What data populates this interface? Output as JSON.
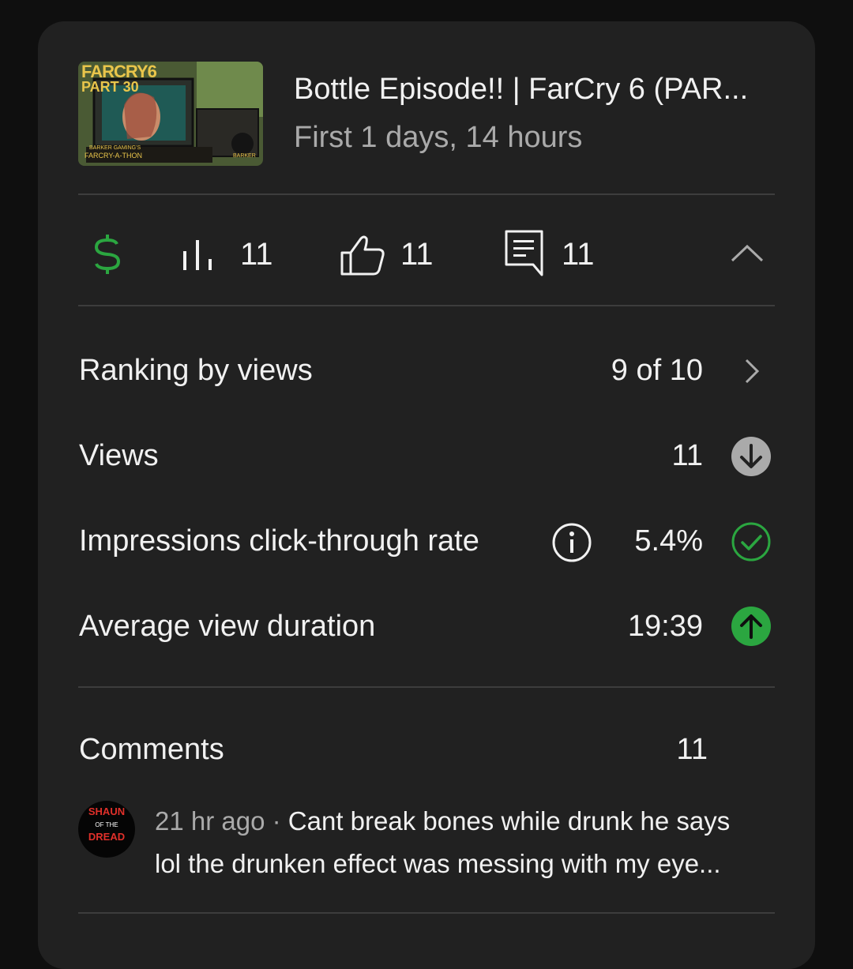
{
  "video": {
    "title": "Bottle Episode!! | FarCry 6 (PAR...",
    "subtitle": "First 1 days, 14 hours",
    "thumbnail": {
      "logo_text": "FARCRY6",
      "part_text": "PART 30",
      "caption_top": "BARKER GAMING'S",
      "caption_bottom": "FARCRY-A-THON",
      "badge_text": "BARKER"
    }
  },
  "stats": {
    "views": "11",
    "likes": "11",
    "comments": "11"
  },
  "metrics": {
    "ranking": {
      "label": "Ranking by views",
      "value": "9 of 10"
    },
    "views": {
      "label": "Views",
      "value": "11"
    },
    "ctr": {
      "label": "Impressions click-through rate",
      "value": "5.4%"
    },
    "avd": {
      "label": "Average view duration",
      "value": "19:39"
    }
  },
  "comments": {
    "label": "Comments",
    "count": "11",
    "items": [
      {
        "avatar_line1": "SHAUN",
        "avatar_line2": "OF THE",
        "avatar_line3": "DREAD",
        "time": "21 hr ago",
        "separator": " · ",
        "text_line1": "Cant break bones while drunk he says",
        "text_line2": "lol the drunken effect was messing with my eye..."
      }
    ]
  },
  "colors": {
    "background": "#0f0f0f",
    "card": "#212121",
    "green": "#2ba640",
    "neutral_icon": "#aaaaaa",
    "text": "#f1f1f1",
    "secondary_text": "#aaaaaa"
  }
}
